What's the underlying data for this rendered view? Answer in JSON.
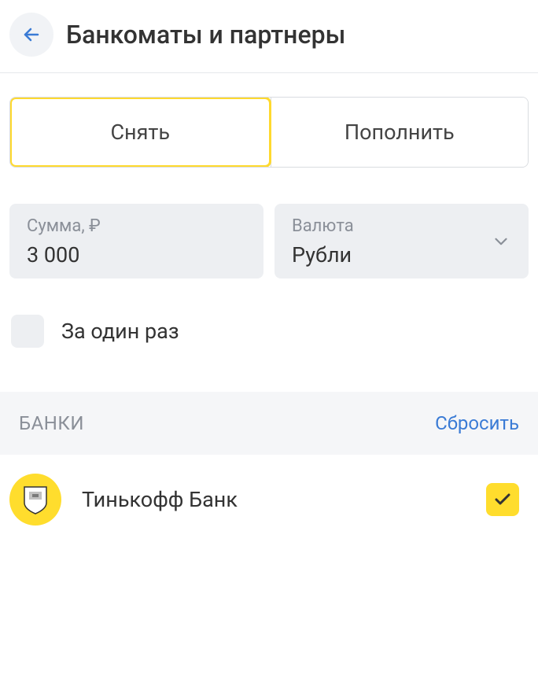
{
  "header": {
    "title": "Банкоматы и партнеры"
  },
  "tabs": {
    "withdraw": "Снять",
    "deposit": "Пополнить"
  },
  "amount": {
    "label": "Сумма, ₽",
    "value": "3 000"
  },
  "currency": {
    "label": "Валюта",
    "value": "Рубли"
  },
  "singleTransaction": {
    "label": "За один раз"
  },
  "banksSection": {
    "title": "БАНКИ",
    "reset": "Сбросить"
  },
  "banks": [
    {
      "name": "Тинькофф Банк",
      "selected": true
    }
  ]
}
